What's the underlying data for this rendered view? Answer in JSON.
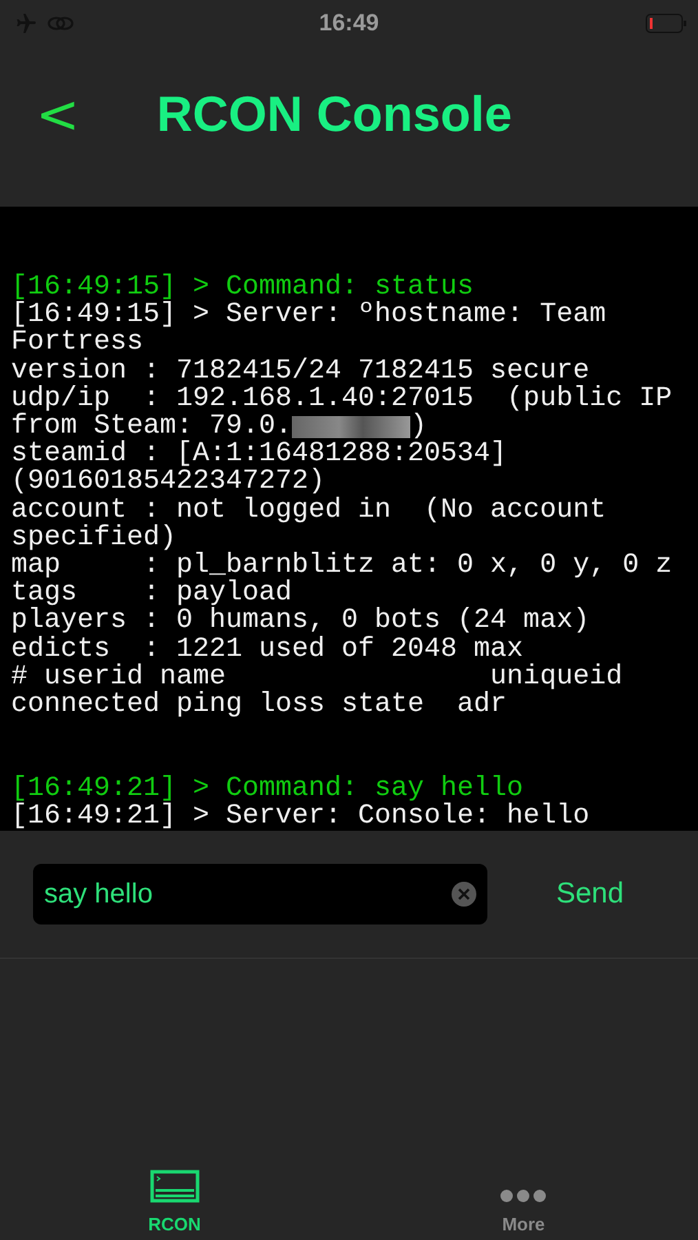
{
  "status_bar": {
    "time": "16:49"
  },
  "nav": {
    "back": "<",
    "title": "RCON Console"
  },
  "console": {
    "lines": [
      {
        "kind": "command",
        "text": "[16:49:15] > Command: status",
        "gap_before": false
      },
      {
        "kind": "output",
        "text": "[16:49:15] > Server: ºhostname: Team",
        "gap_before": false
      },
      {
        "kind": "output",
        "text": "Fortress",
        "gap_before": false
      },
      {
        "kind": "output",
        "text": "version : 7182415/24 7182415 secure",
        "gap_before": false
      },
      {
        "kind": "output",
        "text": "udp/ip  : 192.168.1.40:27015  (public IP",
        "gap_before": false
      },
      {
        "kind": "output",
        "text": "from Steam: 79.0.",
        "redacted": true,
        "after": ")",
        "gap_before": false
      },
      {
        "kind": "output",
        "text": "steamid : [A:1:16481288:20534]",
        "gap_before": false
      },
      {
        "kind": "output",
        "text": "(90160185422347272)",
        "gap_before": false
      },
      {
        "kind": "output",
        "text": "account : not logged in  (No account",
        "gap_before": false
      },
      {
        "kind": "output",
        "text": "specified)",
        "gap_before": false
      },
      {
        "kind": "output",
        "text": "map     : pl_barnblitz at: 0 x, 0 y, 0 z",
        "gap_before": false
      },
      {
        "kind": "output",
        "text": "tags    : payload",
        "gap_before": false
      },
      {
        "kind": "output",
        "text": "players : 0 humans, 0 bots (24 max)",
        "gap_before": false
      },
      {
        "kind": "output",
        "text": "edicts  : 1221 used of 2048 max",
        "gap_before": false
      },
      {
        "kind": "output",
        "text": "# userid name                uniqueid",
        "gap_before": false
      },
      {
        "kind": "output",
        "text": "connected ping loss state  adr",
        "gap_before": false
      },
      {
        "kind": "command",
        "text": "[16:49:21] > Command: say hello",
        "gap_before": true
      },
      {
        "kind": "output",
        "text": "[16:49:21] > Server: Console: hello",
        "gap_before": false
      }
    ]
  },
  "input": {
    "value": "say hello",
    "send": "Send"
  },
  "tabs": [
    {
      "label": "RCON",
      "selected": true
    },
    {
      "label": "More",
      "selected": false
    }
  ]
}
